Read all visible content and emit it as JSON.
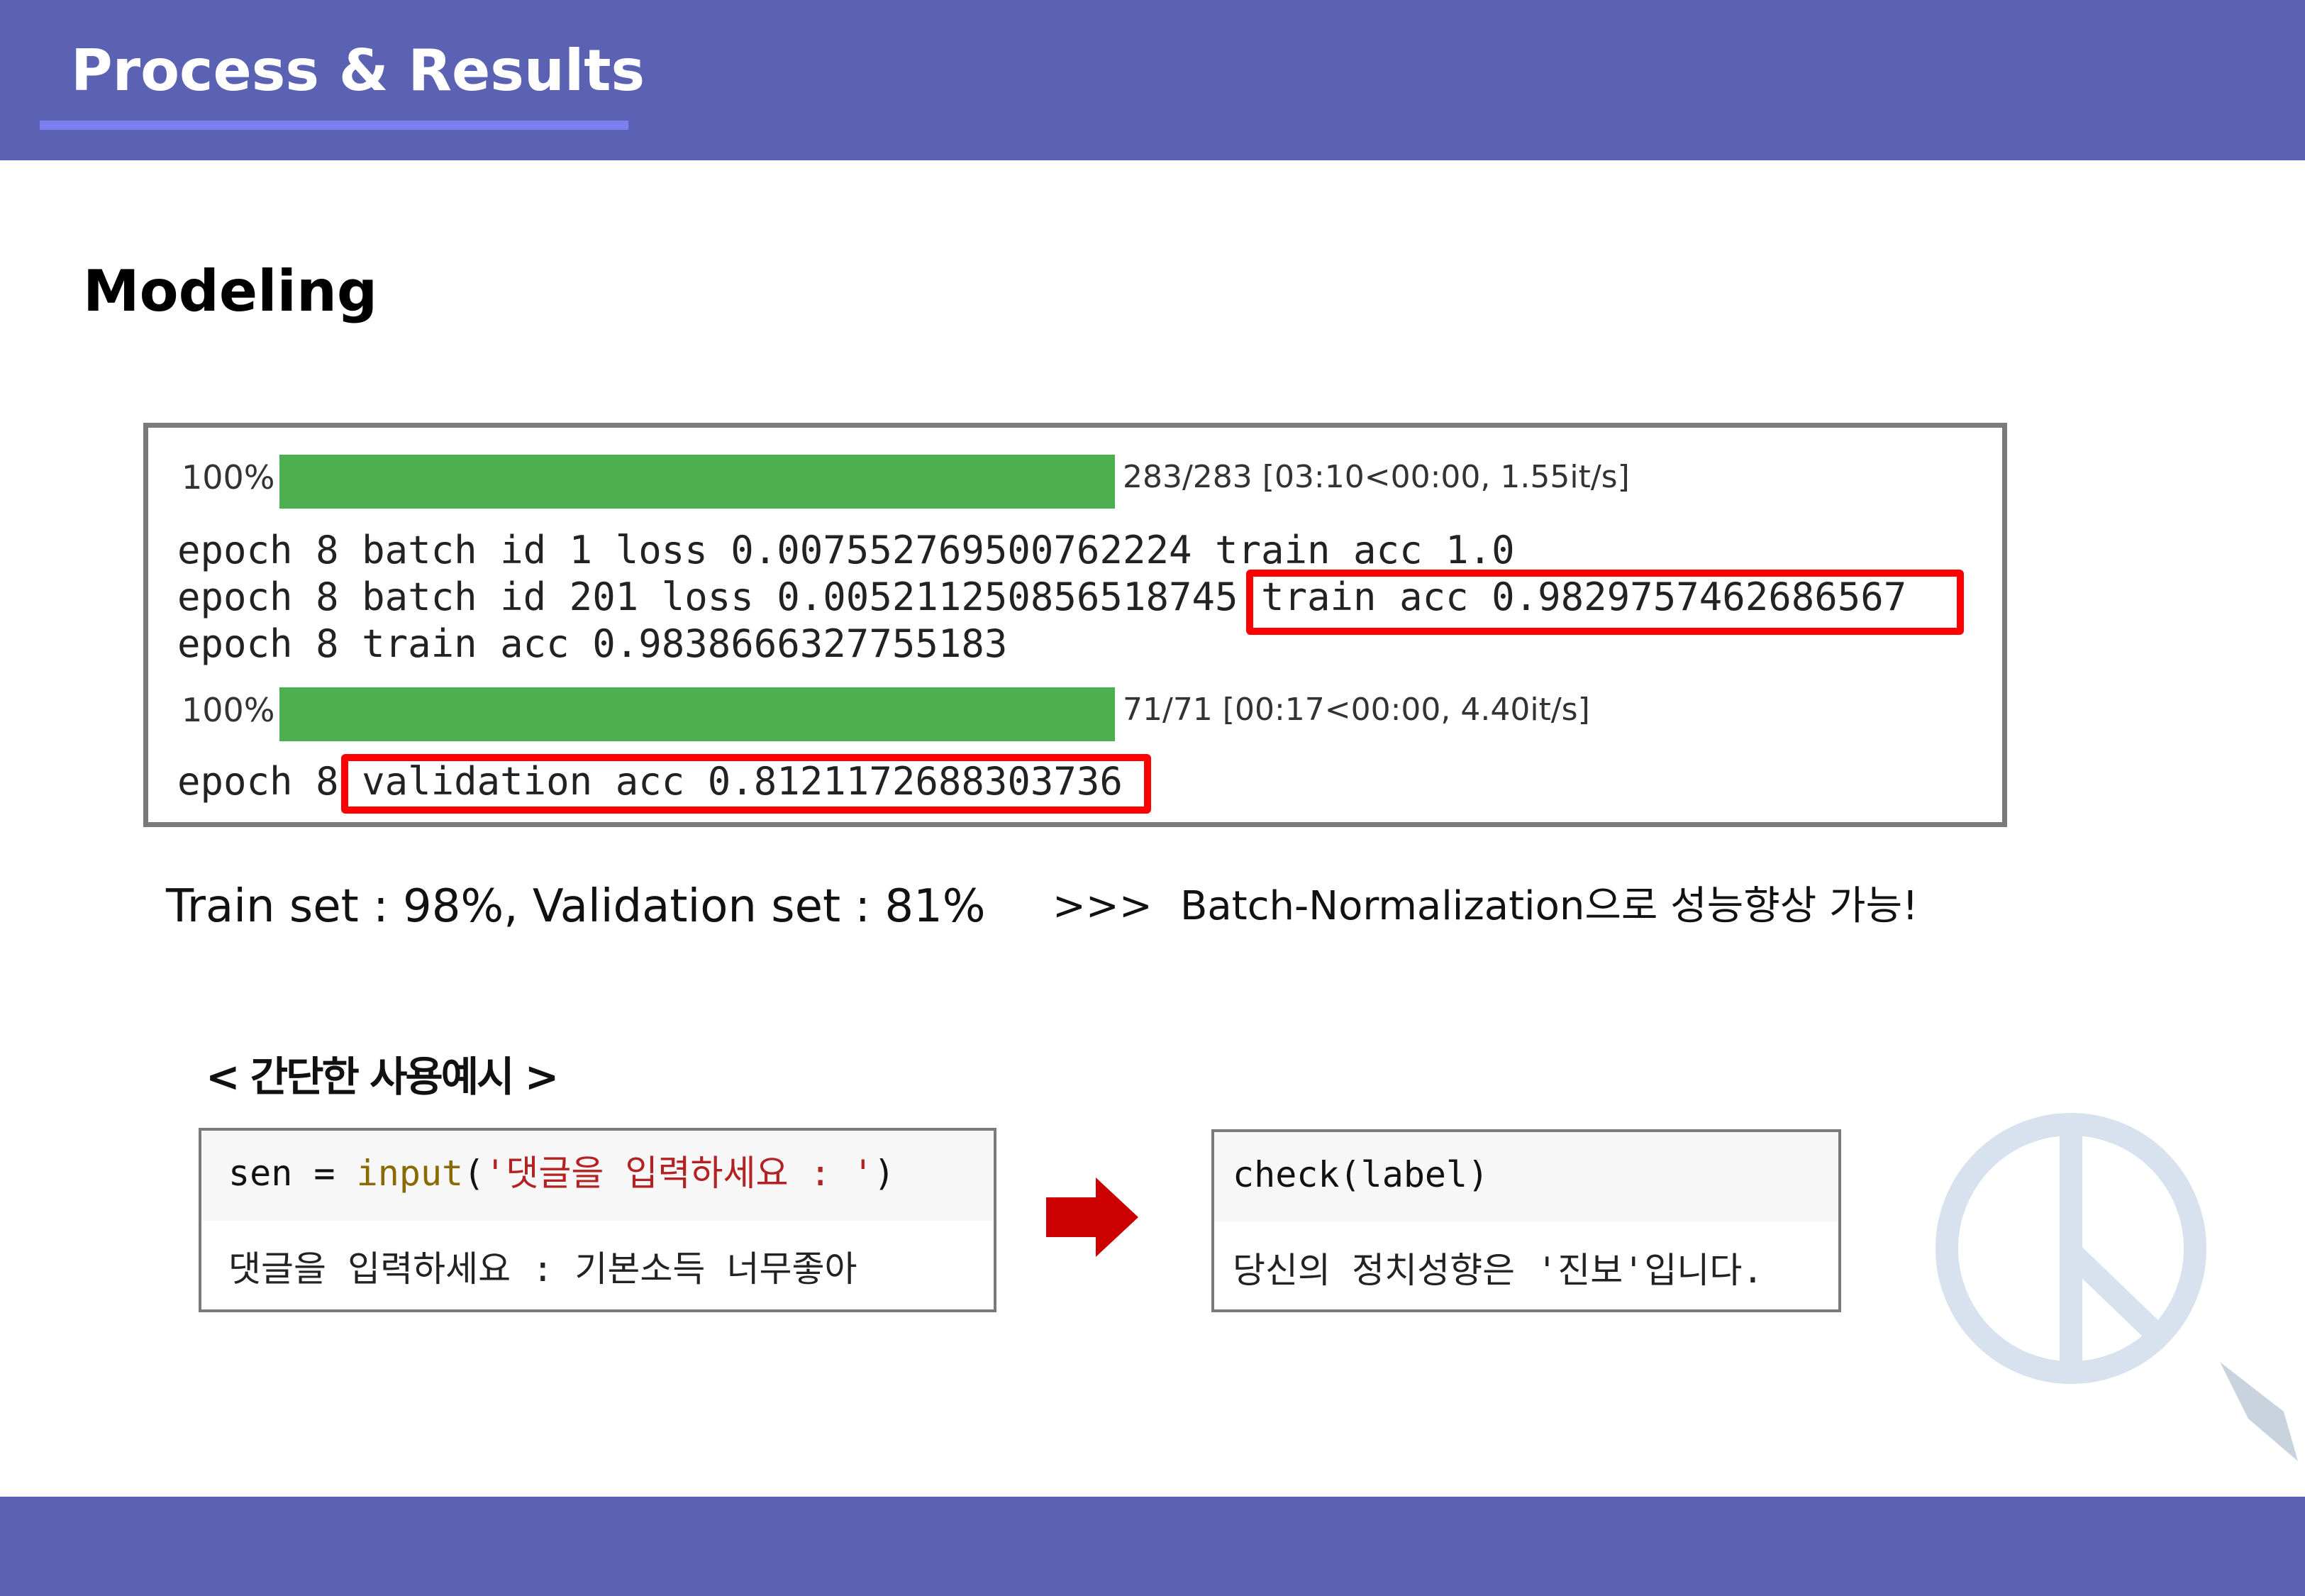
{
  "header": {
    "title": "Process & Results"
  },
  "section": {
    "title": "Modeling"
  },
  "training_log": {
    "progress_bars": [
      {
        "percent_label": "100%",
        "progress": 1.0,
        "stats": "283/283 [03:10<00:00, 1.55it/s]"
      },
      {
        "percent_label": "100%",
        "progress": 1.0,
        "stats": "71/71 [00:17<00:00, 4.40it/s]"
      }
    ],
    "lines": [
      "epoch 8 batch id 1 loss 0.007552769500762224 train acc 1.0",
      "epoch 8 batch id 201 loss 0.005211250856518745 train acc 0.9829757462686567",
      "epoch 8 train acc 0.9838666327755183"
    ],
    "validation_line": "epoch 8 validation acc 0.8121172688303736",
    "highlight_color": "#ff0000",
    "progress_color": "#4caf50"
  },
  "summary": {
    "text": "Train set : 98%, Validation set : 81%",
    "separator": ">>>",
    "note": "Batch-Normalization으로 성능향상 가능!"
  },
  "example": {
    "title": "< 간단한 사용예시 >",
    "input_cell": {
      "var": "sen",
      "op": "=",
      "func": "input",
      "arg": "'댓글을 입력하세요 : '",
      "output": "댓글을 입력하세요 : 기본소득 너무좋아"
    },
    "result_cell": {
      "code": "check(label)",
      "output": "당신의 정치성향은 '진보'입니다."
    }
  },
  "colors": {
    "header_bg": "#5b62b4",
    "accent_line": "#7b80f0",
    "arrow": "#cc0000"
  }
}
